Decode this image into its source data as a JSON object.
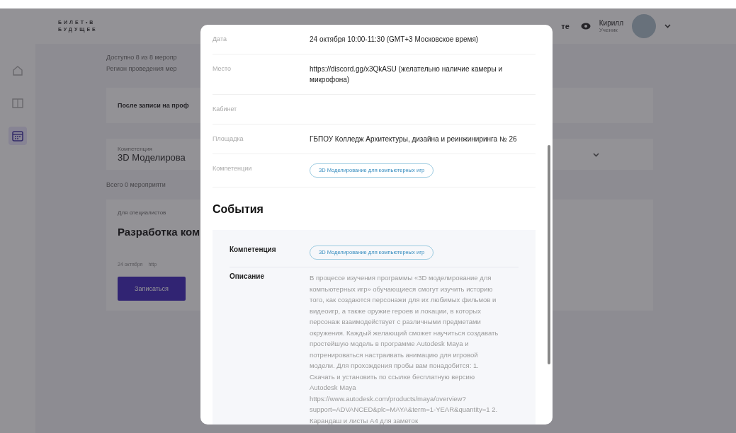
{
  "header": {
    "logo_line_1": "БИЛЕТ•В",
    "logo_line_2": "БУДУЩЕЕ",
    "nav_link": "те",
    "user_name": "Кирилл",
    "user_role": "Ученик"
  },
  "sidebar": {
    "items": [
      {
        "kind": "home",
        "selected": false
      },
      {
        "kind": "book",
        "selected": false
      },
      {
        "kind": "calendar",
        "selected": true
      }
    ]
  },
  "background": {
    "available": "Доступно 8 из 8 меропр",
    "region": "Регион проведения мер",
    "notice": "После записи на проф",
    "filter": {
      "label": "Компетенция",
      "value": "3D Моделирова"
    },
    "total": "Всего 0 мероприяти",
    "event_card": {
      "audience": "Для специалистов",
      "title": "Разработка ком",
      "date": "24 октября",
      "place": "http",
      "button": "Записаться"
    }
  },
  "modal": {
    "details": [
      {
        "kind": "text",
        "label": "Дата",
        "value": "24 октября 10:00-11:30 (GMT+3 Московское время)"
      },
      {
        "kind": "text",
        "label": "Место",
        "value": "https://discord.gg/x3QkASU (желательно наличие камеры и микрофона)"
      },
      {
        "kind": "text",
        "label": "Кабинет"
      },
      {
        "kind": "text",
        "label": "Площадка",
        "value": "ГБПОУ Колледж Архитектуры, дизайна и реинжиниринга № 26"
      },
      {
        "kind": "tag",
        "label": "Компетенции",
        "value": "3D Моделирование для компьютерных игр"
      }
    ],
    "events_title": "События",
    "event": {
      "competence_label": "Компетенция",
      "competence": "3D Моделирование для компьютерных игр",
      "description_label": "Описание",
      "description": "В процессе изучения программы «3D моделирование для компьютерных игр» обучающиеся смогут изучить историю того, как создаются персонажи для их любимых фильмов и видеоигр, а также оружие героев и локации, в которых персонаж взаимодействует с различными предметами окружения. Каждый желающий сможет научиться создавать простейшую модель в программе Autodesk Maya и потренироваться настраивать анимацию для игровой модели. Для прохождения пробы вам понадобится: 1. Скачать и установить по ссылке бесплатную версию Autodesk Maya https://www.autodesk.com/products/maya/overview?support=ADVANCED&plc=MAYA&term=1-YEAR&quantity=1 2. Карандаш и листы А4 для заметок"
    }
  }
}
